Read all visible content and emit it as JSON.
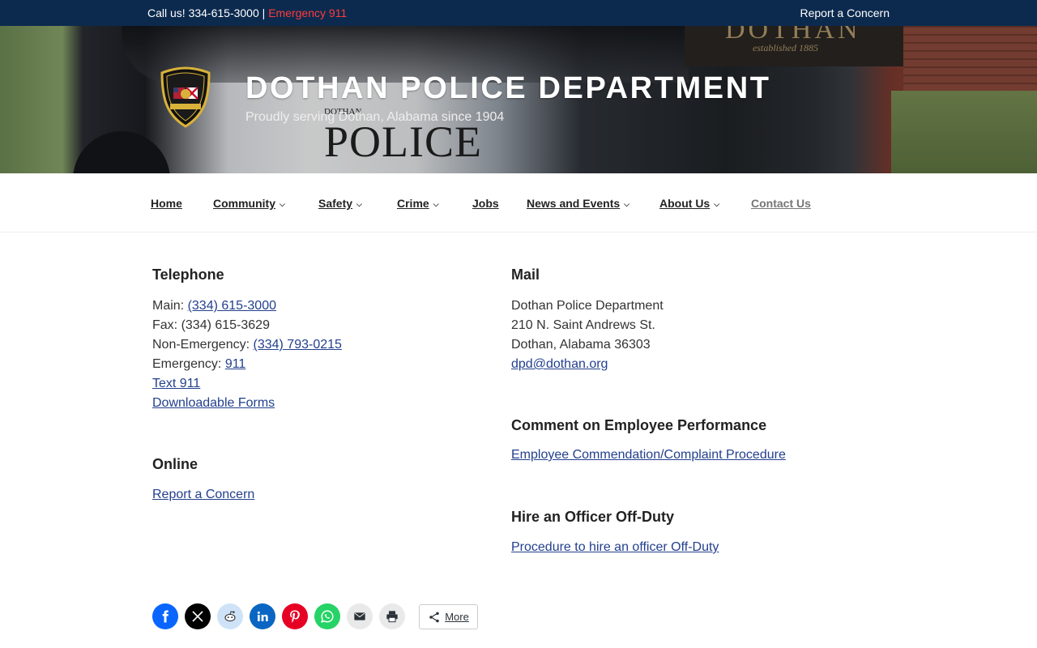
{
  "topbar": {
    "call_text": "Call us! 334-615-3000 | ",
    "emergency_text": "Emergency 911",
    "report_link": "Report a Concern"
  },
  "header": {
    "sign_line1": "DOTHAN",
    "sign_line2": "established 1885",
    "door_small": "DOTHAN",
    "door_big": "POLICE",
    "title": "DOTHAN POLICE DEPARTMENT",
    "tagline": "Proudly serving Dothan, Alabama since 1904"
  },
  "nav": {
    "items": [
      {
        "label": "Home",
        "dropdown": false
      },
      {
        "label": "Community",
        "dropdown": true
      },
      {
        "label": "Safety",
        "dropdown": true
      },
      {
        "label": "Crime",
        "dropdown": true
      },
      {
        "label": "Jobs",
        "dropdown": false
      },
      {
        "label": "News and Events",
        "dropdown": true
      },
      {
        "label": "About Us",
        "dropdown": true
      },
      {
        "label": "Contact Us",
        "dropdown": false,
        "active": true
      }
    ]
  },
  "telephone": {
    "heading": "Telephone",
    "main_label": "Main: ",
    "main_value": "(334) 615-3000",
    "fax": "Fax: (334) 615-3629",
    "nonemergency_label": "Non-Emergency: ",
    "nonemergency_value": "(334) 793-0215",
    "emergency_label": "Emergency: ",
    "emergency_value": "911",
    "text911": "Text 911",
    "forms": "Downloadable Forms"
  },
  "online": {
    "heading": "Online",
    "report": "Report a Concern"
  },
  "mail": {
    "heading": "Mail",
    "line1": "Dothan Police Department",
    "line2": "210 N. Saint Andrews St.",
    "line3": "Dothan, Alabama 36303",
    "email": "dpd@dothan.org"
  },
  "comment": {
    "heading": "Comment on Employee Performance",
    "link": "Employee Commendation/Complaint Procedure"
  },
  "hire": {
    "heading": "Hire an Officer Off-Duty",
    "link": "Procedure to hire an officer Off-Duty"
  },
  "share": {
    "more_label": "More",
    "buttons": [
      {
        "icon": "facebook-icon",
        "color": "#0866ff"
      },
      {
        "icon": "x-icon",
        "color": "#000000"
      },
      {
        "icon": "reddit-icon",
        "color": "#cee3f8"
      },
      {
        "icon": "linkedin-icon",
        "color": "#0a66c2"
      },
      {
        "icon": "pinterest-icon",
        "color": "#e60023"
      },
      {
        "icon": "whatsapp-icon",
        "color": "#25d366"
      },
      {
        "icon": "email-icon",
        "color": "#e9e9e9"
      },
      {
        "icon": "print-icon",
        "color": "#e9e9e9"
      }
    ]
  },
  "colors": {
    "topbar_bg": "#0c2a4e",
    "emergency": "#ff3b3b",
    "link": "#23408e"
  }
}
